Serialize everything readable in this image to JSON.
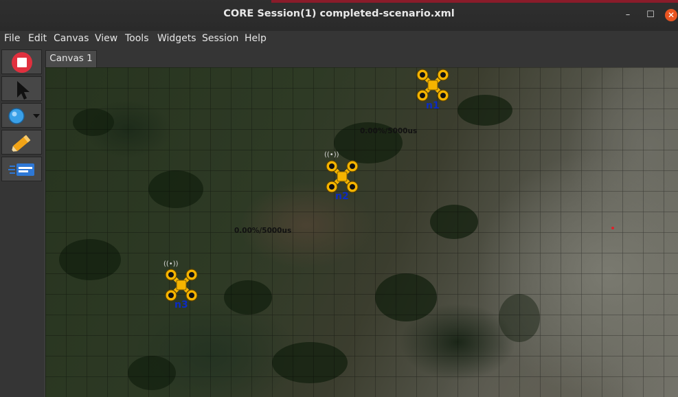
{
  "window": {
    "title": "CORE Session(1) completed-scenario.xml",
    "minimize": "–",
    "maximize": "☐",
    "close": "✕"
  },
  "menu": [
    "File",
    "Edit",
    "Canvas",
    "View",
    "Tools",
    "Widgets",
    "Session",
    "Help"
  ],
  "toolbar": {
    "tools": [
      {
        "name": "stop-session-icon"
      },
      {
        "name": "select-pointer-icon"
      },
      {
        "name": "marker-zoom-icon"
      },
      {
        "name": "pencil-icon"
      },
      {
        "name": "run-tool-icon"
      }
    ]
  },
  "tabs": [
    "Canvas 1"
  ],
  "canvas": {
    "nodes": [
      {
        "id": "n1",
        "label": "n1",
        "icon": "drone-icon"
      },
      {
        "id": "n2",
        "label": "n2",
        "icon": "drone-icon"
      },
      {
        "id": "n3",
        "label": "n3",
        "icon": "drone-icon"
      }
    ],
    "link_labels": [
      "0.00%/5000us",
      "0.00%/5000us"
    ],
    "colors": {
      "drone": "#f5b400",
      "node_label": "#0b2bc4",
      "stop_button": "#e0303e"
    }
  }
}
